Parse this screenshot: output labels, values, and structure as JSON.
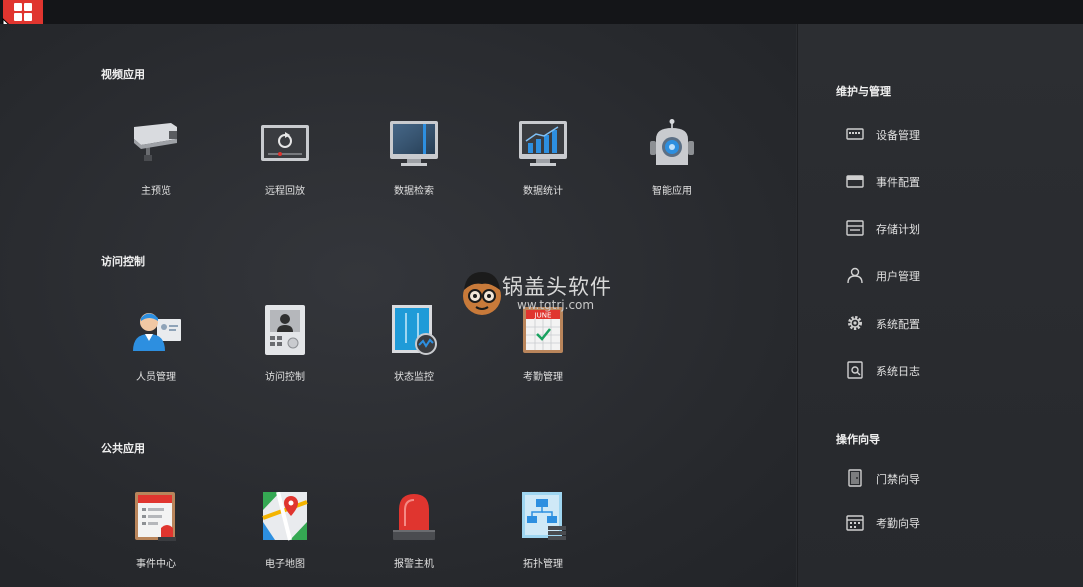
{
  "sections": {
    "video": {
      "title": "视频应用",
      "apps": [
        {
          "label": "主预览",
          "icon": "cctv-camera-icon"
        },
        {
          "label": "远程回放",
          "icon": "remote-playback-icon"
        },
        {
          "label": "数据检索",
          "icon": "data-search-monitor-icon"
        },
        {
          "label": "数据统计",
          "icon": "bar-chart-monitor-icon"
        },
        {
          "label": "智能应用",
          "icon": "robot-icon"
        }
      ]
    },
    "access": {
      "title": "访问控制",
      "apps": [
        {
          "label": "人员管理",
          "icon": "person-id-card-icon"
        },
        {
          "label": "访问控制",
          "icon": "door-intercom-icon"
        },
        {
          "label": "状态监控",
          "icon": "door-status-icon"
        },
        {
          "label": "考勤管理",
          "icon": "calendar-check-icon"
        }
      ]
    },
    "public": {
      "title": "公共应用",
      "apps": [
        {
          "label": "事件中心",
          "icon": "event-center-alarm-icon"
        },
        {
          "label": "电子地图",
          "icon": "map-pin-icon"
        },
        {
          "label": "报警主机",
          "icon": "alarm-beacon-icon"
        },
        {
          "label": "拓扑管理",
          "icon": "topology-icon"
        }
      ]
    }
  },
  "calendar_badge": "JUNE",
  "sidebar": {
    "maintenance": {
      "title": "维护与管理",
      "items": [
        {
          "label": "设备管理",
          "icon": "device-icon"
        },
        {
          "label": "事件配置",
          "icon": "event-config-icon"
        },
        {
          "label": "存储计划",
          "icon": "storage-icon"
        },
        {
          "label": "用户管理",
          "icon": "user-icon"
        },
        {
          "label": "系统配置",
          "icon": "gear-icon"
        },
        {
          "label": "系统日志",
          "icon": "log-icon"
        }
      ]
    },
    "wizard": {
      "title": "操作向导",
      "items": [
        {
          "label": "门禁向导",
          "icon": "door-icon"
        },
        {
          "label": "考勤向导",
          "icon": "calendar-icon"
        }
      ]
    }
  },
  "watermark": {
    "text": "锅盖头软件",
    "url": "ww.tgtrj.com"
  },
  "colors": {
    "accent": "#e0352f",
    "blue": "#2d8fe0",
    "background": "#2a2c30"
  }
}
